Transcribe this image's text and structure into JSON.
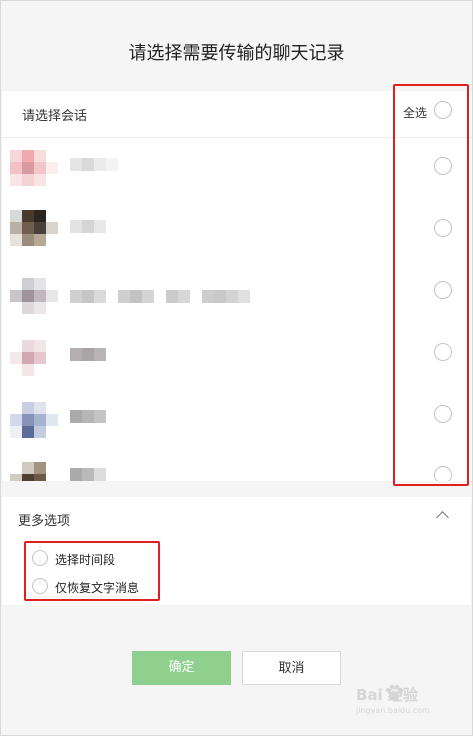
{
  "dialog": {
    "title": "请选择需要传输的聊天记录"
  },
  "selection": {
    "header_label": "请选择会话",
    "select_all_label": "全选",
    "rows": [
      {
        "checked": false
      },
      {
        "checked": false
      },
      {
        "checked": false
      },
      {
        "checked": false
      },
      {
        "checked": false
      },
      {
        "checked": false
      }
    ]
  },
  "more_options": {
    "title": "更多选项",
    "options": [
      {
        "label": "选择时间段",
        "checked": false
      },
      {
        "label": "仅恢复文字消息",
        "checked": false
      }
    ]
  },
  "footer": {
    "confirm_label": "确定",
    "cancel_label": "取消"
  },
  "watermark": {
    "text": "Bai 经验",
    "sub": "jingyan.baidu.com"
  },
  "colors": {
    "confirm_bg": "#8fd08f",
    "highlight_border": "#e02020",
    "background": "#f5f5f5"
  }
}
